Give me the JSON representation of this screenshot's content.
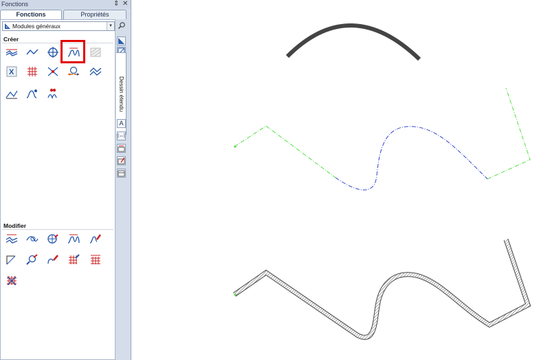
{
  "titlebar": {
    "title": "Fonctions",
    "pin": "⇕",
    "close": "✕"
  },
  "tabs": [
    {
      "label": "Fonctions"
    },
    {
      "label": "Propriétés"
    }
  ],
  "dropdown": {
    "value": "Modules généraux"
  },
  "sections": {
    "create": "Créer",
    "modify": "Modifier"
  },
  "side_tab": {
    "label": "Dessin étendu"
  },
  "side_buttons": [
    "A",
    "|↔|",
    "",
    "",
    ""
  ],
  "create_icons": [
    "wall-line-icon",
    "polyline-icon",
    "circle-cross-icon",
    "curve-wall-icon",
    "hatch-disabled-icon",
    "table-x-icon",
    "grid-icon",
    "connect-points-icon",
    "globe-arrows-icon",
    "double-line-icon",
    "profile-icon",
    "spline-profile-icon",
    "dots-wave-icon"
  ],
  "modify_icons": [
    "modify-wall-icon",
    "modify-line-icon",
    "modify-circle-icon",
    "modify-curve-icon",
    "modify-edit-icon",
    "corner-icon",
    "magnify-edit-icon",
    "curve-pencil-icon",
    "grid-edit-icon",
    "grid-edit-2-icon",
    "grid-cross-icon"
  ],
  "colors": {
    "accent_highlight": "#e00000",
    "line_green": "#55dd44",
    "line_blue": "#3344cc",
    "wall_stroke": "#444444"
  }
}
